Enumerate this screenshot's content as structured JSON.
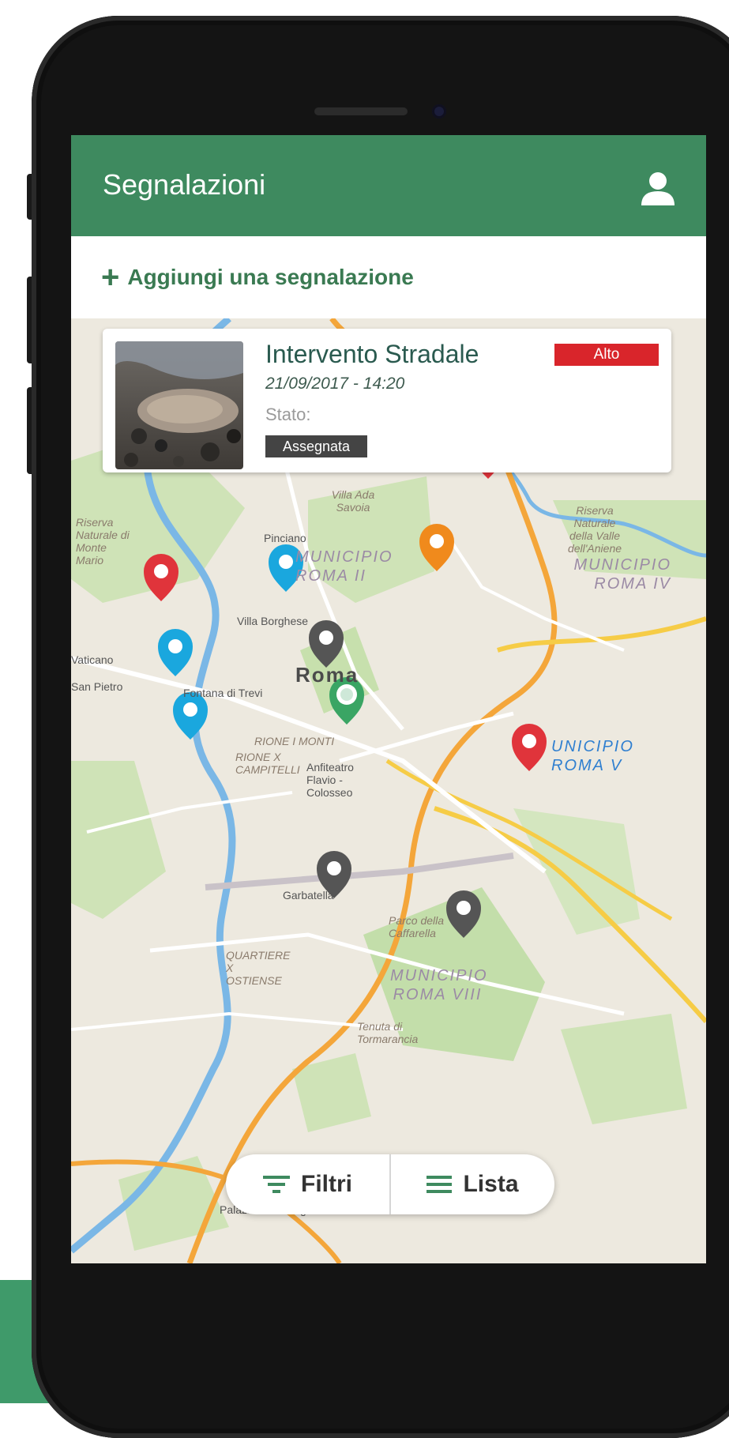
{
  "app": {
    "title": "Segnalazioni",
    "accent": "#3e8a5f"
  },
  "actions": {
    "add_report_label": "Aggiungi una segnalazione"
  },
  "report_card": {
    "title": "Intervento Stradale",
    "datetime": "21/09/2017 - 14:20",
    "status_label": "Stato:",
    "status_value": "Assegnata",
    "priority": "Alto",
    "priority_color": "#d9252b"
  },
  "map": {
    "city_label": "Roma",
    "labels": [
      "Villa Ada Savoia",
      "Pinciano",
      "Villa Borghese",
      "Fontana di Trevi",
      "Vaticano",
      "San Pietro",
      "RIONE I MONTI",
      "RIONE X CAMPITELLI",
      "Anfiteatro Flavio - Colosseo",
      "Garbatella",
      "QUARTIERE X OSTIENSE",
      "Parco della Caffarella",
      "Tenuta di Tormarancia",
      "Riserva Naturale di Monte Mario",
      "Riserva Naturale della Valle dell'Aniene",
      "Palazzo dei Congressi"
    ],
    "districts": [
      "MUNICIPIO ROMA II",
      "MUNICIPIO ROMA IV",
      "UNICIPIO ROMA V",
      "MUNICIPIO ROMA VIII"
    ],
    "pin_colors": {
      "red": "#e0343b",
      "blue": "#1aa7de",
      "gray": "#555555",
      "orange": "#f08a1c",
      "green": "#3aa564"
    }
  },
  "bottom_bar": {
    "filters_label": "Filtri",
    "list_label": "Lista"
  }
}
